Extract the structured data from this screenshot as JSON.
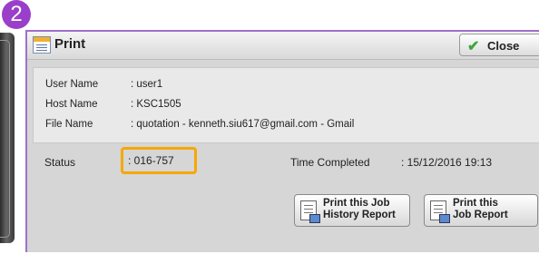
{
  "step_badge": "2",
  "window": {
    "title": "Print",
    "close_label": "Close"
  },
  "info": {
    "user_name_label": "User Name",
    "user_name_value": ": user1",
    "host_name_label": "Host Name",
    "host_name_value": ": KSC1505",
    "file_name_label": "File Name",
    "file_name_value": ": quotation - kenneth.siu617@gmail.com - Gmail"
  },
  "status": {
    "label": "Status",
    "value": ": 016-757",
    "highlight_color": "#f5a800"
  },
  "time_completed": {
    "label": "Time Completed",
    "value": ": 15/12/2016 19:13"
  },
  "buttons": {
    "history_report": {
      "line1": "Print this Job",
      "line2": "History Report"
    },
    "job_report": {
      "line1": "Print this",
      "line2": "Job Report"
    }
  },
  "icons": {
    "title": "print-window-icon",
    "close": "checkmark-icon",
    "report": "document-print-icon"
  },
  "accent_color": "#9a3fc9"
}
